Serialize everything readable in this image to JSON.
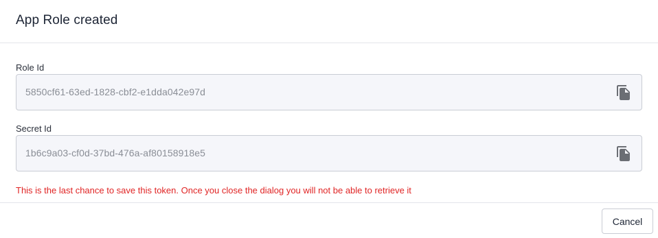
{
  "dialog": {
    "title": "App Role created"
  },
  "fields": {
    "role_id": {
      "label": "Role Id",
      "value": "5850cf61-63ed-1828-cbf2-e1dda042e97d",
      "copy_icon": "copy-icon"
    },
    "secret_id": {
      "label": "Secret Id",
      "value": "1b6c9a03-cf0d-37bd-476a-af80158918e5",
      "copy_icon": "copy-icon"
    }
  },
  "warning": {
    "text": "This is the last chance to save this token. Once you close the dialog you will not be able to retrieve it",
    "color": "#e02424"
  },
  "footer": {
    "cancel_label": "Cancel"
  },
  "colors": {
    "title": "#1c2434",
    "field_background": "#f5f6fa",
    "field_border": "#c9ccd4",
    "value_text": "#8a8e96",
    "icon": "#6b6e74"
  }
}
